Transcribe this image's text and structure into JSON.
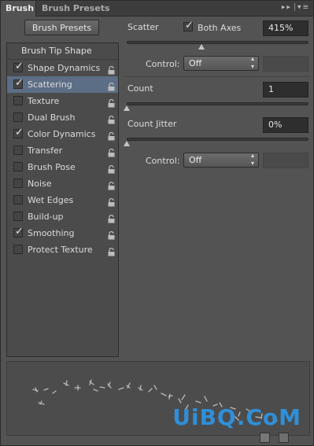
{
  "tabs": [
    {
      "label": "Brush",
      "active": true
    },
    {
      "label": "Brush Presets",
      "active": false
    }
  ],
  "brush_presets_button": "Brush Presets",
  "list_header": "Brush Tip Shape",
  "list_items": [
    {
      "label": "Shape Dynamics",
      "checked": true,
      "selected": false
    },
    {
      "label": "Scattering",
      "checked": true,
      "selected": true
    },
    {
      "label": "Texture",
      "checked": false,
      "selected": false
    },
    {
      "label": "Dual Brush",
      "checked": false,
      "selected": false
    },
    {
      "label": "Color Dynamics",
      "checked": true,
      "selected": false
    },
    {
      "label": "Transfer",
      "checked": false,
      "selected": false
    },
    {
      "label": "Brush Pose",
      "checked": false,
      "selected": false
    },
    {
      "label": "Noise",
      "checked": false,
      "selected": false
    },
    {
      "label": "Wet Edges",
      "checked": false,
      "selected": false
    },
    {
      "label": "Build-up",
      "checked": false,
      "selected": false
    },
    {
      "label": "Smoothing",
      "checked": true,
      "selected": false
    },
    {
      "label": "Protect Texture",
      "checked": false,
      "selected": false
    }
  ],
  "scatter": {
    "label": "Scatter",
    "both_axes_label": "Both Axes",
    "both_axes_checked": true,
    "value": "415%",
    "slider_fraction": 0.41
  },
  "control1": {
    "label": "Control:",
    "value": "Off"
  },
  "count": {
    "label": "Count",
    "value": "1",
    "slider_fraction": 0.0
  },
  "count_jitter": {
    "label": "Count Jitter",
    "value": "0%",
    "slider_fraction": 0.0
  },
  "control2": {
    "label": "Control:",
    "value": "Off"
  },
  "watermark": "UiBQ.CoM",
  "colors": {
    "panel": "#535353",
    "selection": "#5c6e85",
    "field": "#2e2e2e",
    "watermark": "#2f8fd8"
  }
}
